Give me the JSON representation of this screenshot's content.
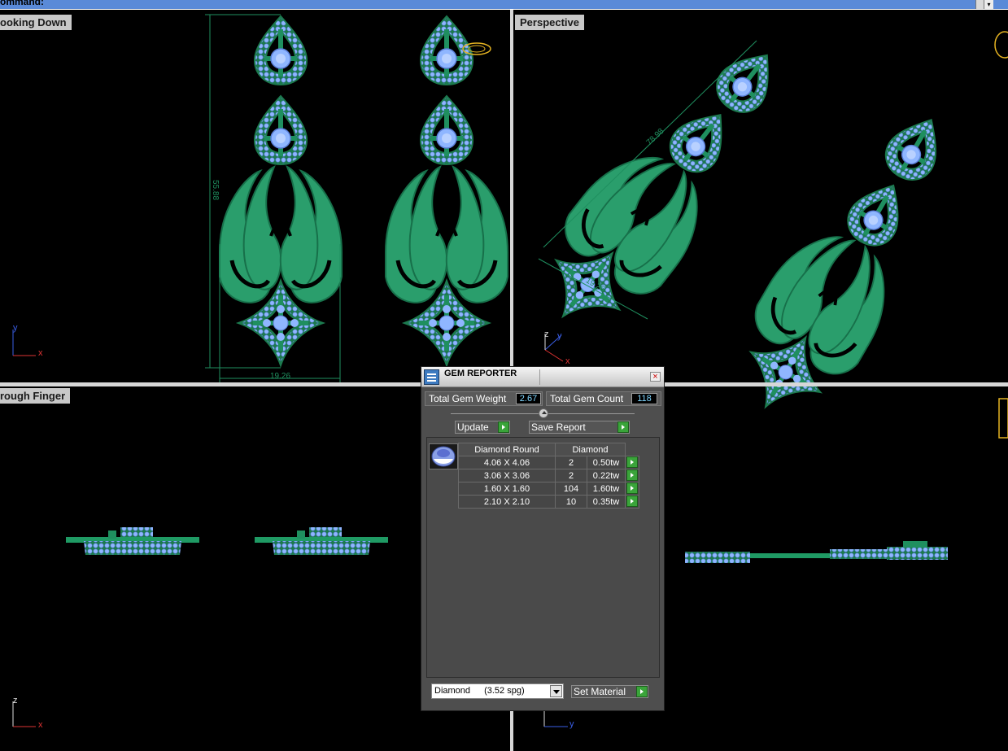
{
  "command_bar": {
    "label": "ommand:"
  },
  "viewports": {
    "top_left": {
      "title": "ooking Down"
    },
    "top_right": {
      "title": "Perspective"
    },
    "bottom_left": {
      "title": "rough Finger"
    }
  },
  "dimensions": {
    "height": "55.88",
    "width_top": "19.26",
    "diag_len": "78.98",
    "diag_width": "19.26"
  },
  "axes": {
    "y": "y",
    "x": "x",
    "z": "z"
  },
  "gem_reporter": {
    "title": "GEM REPORTER",
    "total_weight_label": "Total Gem Weight",
    "total_weight": "2.67",
    "total_count_label": "Total Gem Count",
    "total_count": "118",
    "update_label": "Update",
    "save_report_label": "Save Report",
    "table": {
      "headers": [
        "Diamond Round",
        "Diamond"
      ],
      "rows": [
        {
          "size": "4.06 X 4.06",
          "count": "2",
          "weight": "0.50tw"
        },
        {
          "size": "3.06 X 3.06",
          "count": "2",
          "weight": "0.22tw"
        },
        {
          "size": "1.60 X 1.60",
          "count": "104",
          "weight": "1.60tw"
        },
        {
          "size": "2.10 X 2.10",
          "count": "10",
          "weight": "0.35tw"
        }
      ]
    },
    "material": {
      "name": "Diamond",
      "spg": "(3.52 spg)"
    },
    "set_material_label": "Set Material"
  },
  "colors": {
    "metal": "#1f8f5f",
    "metal_light": "#2fb07a",
    "gem": "#8fb6ff",
    "panel": "#4e4e4e",
    "accent": "#3aa43a"
  }
}
